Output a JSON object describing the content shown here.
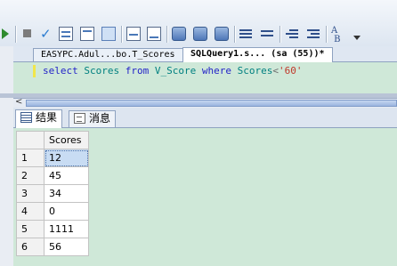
{
  "toolbar": {
    "overflow_icon": "chevron-down-icon"
  },
  "doc_tabs": [
    {
      "label": "EASYPC.Adul...bo.T_Scores"
    },
    {
      "label": "SQLQuery1.s...  (sa (55))*"
    }
  ],
  "editor": {
    "sql": {
      "kw_select": "select",
      "col": "Scores",
      "kw_from": "from",
      "view": "V_Score",
      "kw_where": "where",
      "col2": "Scores",
      "op": "<",
      "literal": "'60'"
    }
  },
  "result_tabs": [
    {
      "label": "结果",
      "icon": "grid-icon"
    },
    {
      "label": "消息",
      "icon": "message-icon"
    }
  ],
  "grid": {
    "columns": [
      "Scores"
    ],
    "rows": [
      {
        "num": "1",
        "value": "12"
      },
      {
        "num": "2",
        "value": "45"
      },
      {
        "num": "3",
        "value": "34"
      },
      {
        "num": "4",
        "value": "0"
      },
      {
        "num": "5",
        "value": "1111"
      },
      {
        "num": "6",
        "value": "56"
      }
    ]
  },
  "colors": {
    "editor_bg": "#cfe8d8",
    "keyword": "#2323c8",
    "identifier": "#008080",
    "string": "#c0392b"
  }
}
